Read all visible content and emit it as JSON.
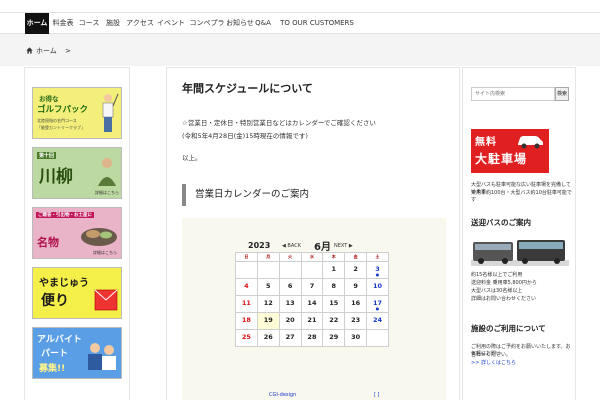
{
  "nav": {
    "items": [
      {
        "label": "ホーム"
      },
      {
        "label": "料金表"
      },
      {
        "label": "コース"
      },
      {
        "label": "施設"
      },
      {
        "label": "アクセス"
      },
      {
        "label": "イベント"
      },
      {
        "label": "コンペプラン"
      },
      {
        "label": "お知らせ"
      },
      {
        "label": "Q&A"
      },
      {
        "label": "TO OUR CUSTOMERS"
      }
    ]
  },
  "breadcrumb": {
    "home_label": "ホーム",
    "separator": ">"
  },
  "left_banners": [
    {
      "line1": "お得な",
      "line2": "ゴルフパック",
      "line3": "北陸屈指の名門コース",
      "line4": "「能登カントリークラブ」",
      "color": "#f3ef7a"
    },
    {
      "line1": "第十回",
      "line2": "川柳",
      "line3": "詳細はこちら",
      "color": "#bcd9a2"
    },
    {
      "line1": "ご贈答・引出物・お土産に",
      "line2": "名物",
      "line3": "詳細はこちら",
      "color": "#e9b3c8"
    },
    {
      "line1": "やまじゅう",
      "line2": "便り",
      "color": "#f5ef4a"
    },
    {
      "line1": "アルバイト",
      "line2": "パート",
      "line3": "募集!!",
      "color": "#5a9ee6"
    }
  ],
  "main": {
    "title": "年間スケジュールについて",
    "line1": "☆営業日・定休日・特別営業日などはカレンダーでご確認ください",
    "line2": "(令和5年4月28日(金)15時現在の情報です)",
    "line3": "以上。",
    "section_heading": "営業日カレンダーのご案内"
  },
  "calendar": {
    "year": "2023",
    "month": "6月",
    "prev_label": "◀ BACK",
    "next_label": "NEXT ▶",
    "header": [
      "日",
      "月",
      "火",
      "水",
      "木",
      "金",
      "土"
    ],
    "rows": [
      [
        "",
        "",
        "",
        "",
        "1",
        "2",
        "3"
      ],
      [
        "4",
        "5",
        "6",
        "7",
        "8",
        "9",
        "10"
      ],
      [
        "11",
        "12",
        "13",
        "14",
        "15",
        "16",
        "17"
      ],
      [
        "18",
        "19",
        "20",
        "21",
        "22",
        "23",
        "24"
      ],
      [
        "25",
        "26",
        "27",
        "28",
        "29",
        "30",
        ""
      ]
    ],
    "credit": "CGI-design",
    "footer_mark": "[ ]"
  },
  "sidebar": {
    "search_placeholder": "サイト内検索",
    "search_button": "検索",
    "parking_line1": "無料",
    "parking_line2": "大駐車場",
    "parking_text1": "大型バスも駐車可能な広い駐車場を完備しています",
    "parking_text2": "乗用車約100台・大型バス約10台駐車可能です",
    "bus_heading": "送迎バスのご案内",
    "bus_text1": "約15名様以上でご利用",
    "bus_text2": "送迎料金 乗用車5,800円から",
    "bus_text3": "大型バスは30名様以上",
    "bus_text4": "詳細はお問い合わせください",
    "guide_heading": "施設のご利用について",
    "guide_text1": "ご利用の際はご予約をお願いいたします。お気軽にお問い",
    "guide_text2": "合わせください。",
    "guide_link": ">> 詳しくはこちら"
  }
}
